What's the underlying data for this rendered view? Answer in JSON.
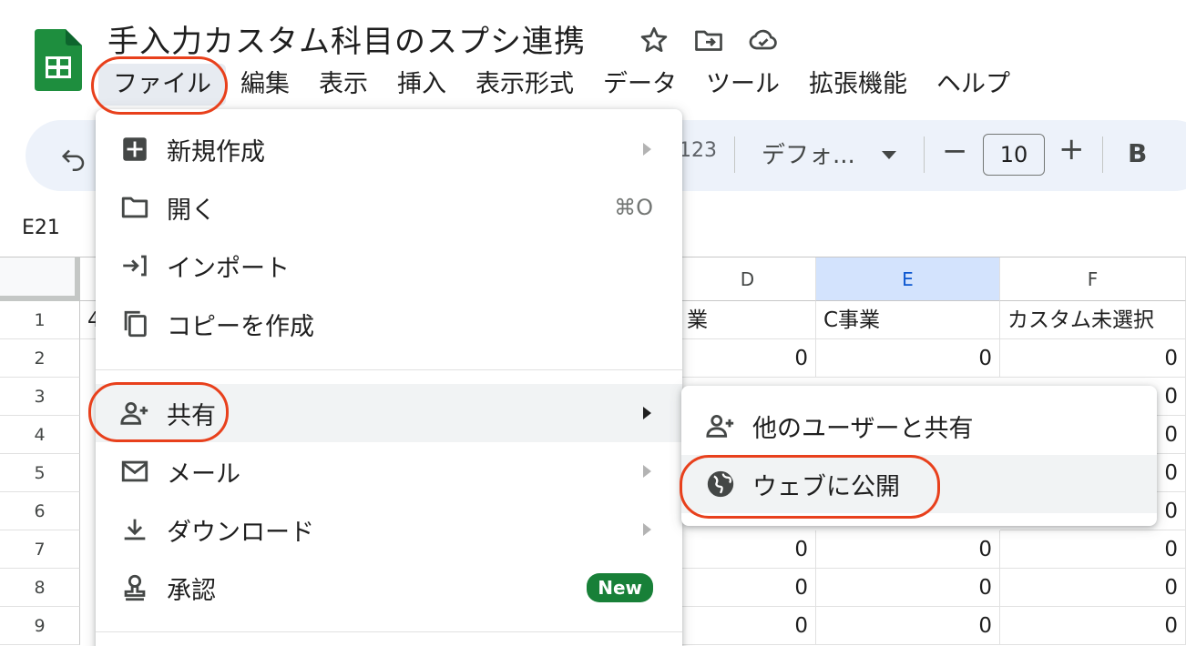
{
  "doc": {
    "title": "手入力カスタム科目のスプシ連携",
    "title_icons": [
      "star-icon",
      "move-folder-icon",
      "cloud-saved-icon"
    ]
  },
  "menubar": [
    "ファイル",
    "編集",
    "表示",
    "挿入",
    "表示形式",
    "データ",
    "ツール",
    "拡張機能",
    "ヘルプ"
  ],
  "toolbar": {
    "number_format": "123",
    "font": "デフォ...",
    "font_size": "10",
    "minus": "−",
    "plus": "+",
    "bold": "B"
  },
  "name_box": "E21",
  "grid": {
    "columns": [
      "D",
      "E",
      "F"
    ],
    "selected_column": "E",
    "rows": [
      "1",
      "2",
      "3",
      "4",
      "5",
      "6",
      "7",
      "8",
      "9"
    ],
    "row1": {
      "b_partial": "4",
      "d": "業",
      "e": "C事業",
      "f": "カスタム未選択"
    },
    "zero": "0"
  },
  "file_menu": {
    "items": [
      {
        "label": "新規作成",
        "icon": "new-sheet-icon",
        "arrow": true
      },
      {
        "label": "開く",
        "icon": "folder-icon",
        "shortcut": "⌘O"
      },
      {
        "label": "インポート",
        "icon": "import-icon"
      },
      {
        "label": "コピーを作成",
        "icon": "copy-icon"
      },
      {
        "label": "共有",
        "icon": "share-person-icon",
        "arrow": true
      },
      {
        "label": "メール",
        "icon": "mail-icon",
        "arrow": true
      },
      {
        "label": "ダウンロード",
        "icon": "download-icon",
        "arrow": true
      },
      {
        "label": "承認",
        "icon": "approval-icon",
        "badge": "New"
      }
    ]
  },
  "share_submenu": {
    "items": [
      {
        "label": "他のユーザーと共有",
        "icon": "share-person-icon"
      },
      {
        "label": "ウェブに公開",
        "icon": "globe-icon"
      }
    ]
  },
  "colors": {
    "sheets_green": "#188038",
    "annotation_red": "#e8401c",
    "selected_column_bg": "#d3e3fd",
    "toolbar_bg": "#edf2fa"
  }
}
